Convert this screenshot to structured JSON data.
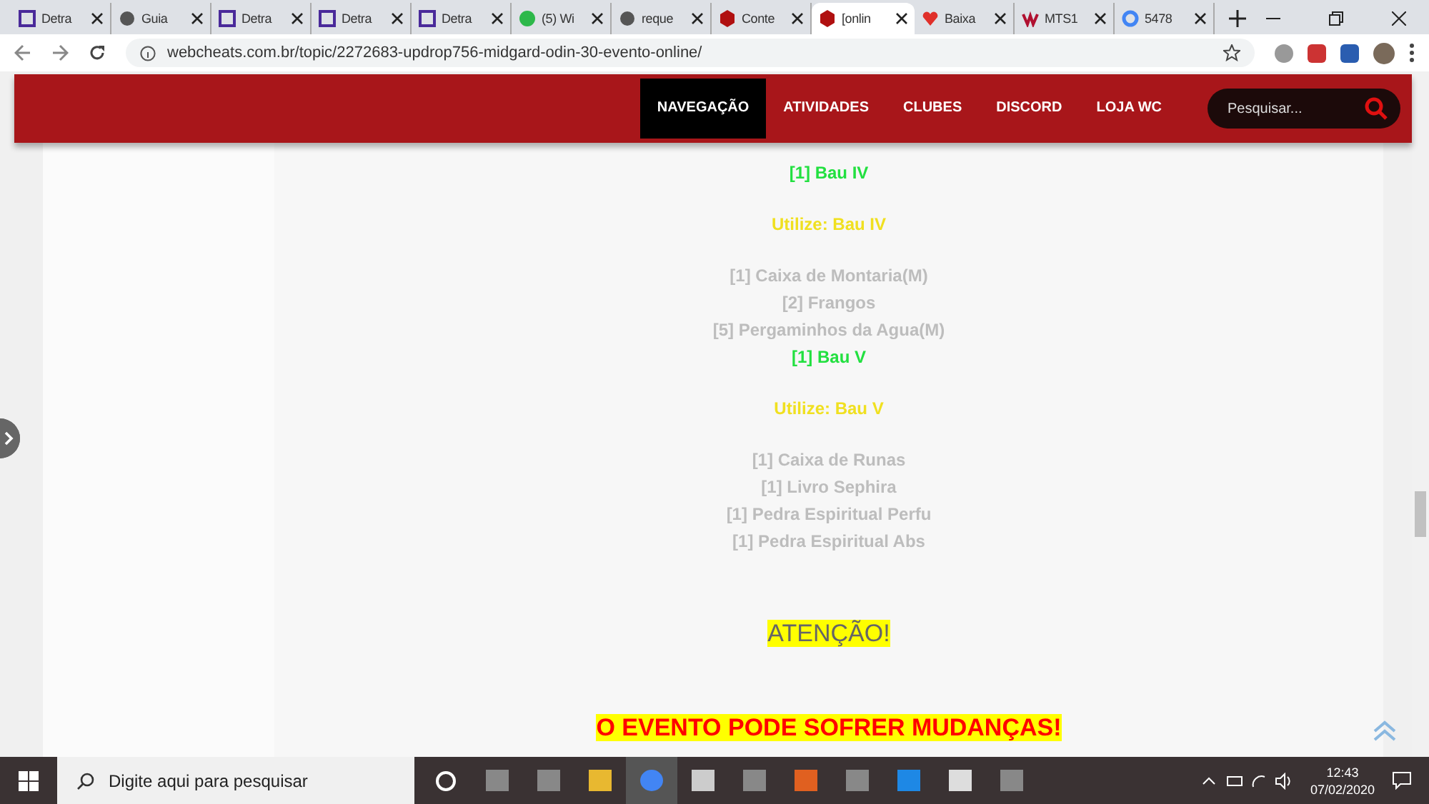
{
  "tabs": [
    {
      "title": "Detra",
      "selected": false
    },
    {
      "title": "Guia",
      "selected": false
    },
    {
      "title": "Detra",
      "selected": false
    },
    {
      "title": "Detra",
      "selected": false
    },
    {
      "title": "Detra",
      "selected": false
    },
    {
      "title": "(5) Wi",
      "selected": false
    },
    {
      "title": "reque",
      "selected": false
    },
    {
      "title": "Conte",
      "selected": false
    },
    {
      "title": "[onlin",
      "selected": true
    },
    {
      "title": "Baixa",
      "selected": false
    },
    {
      "title": "MTS1",
      "selected": false
    },
    {
      "title": "5478",
      "selected": false
    }
  ],
  "address": "webcheats.com.br/topic/2272683-updrop756-midgard-odin-30-evento-online/",
  "nav": [
    {
      "label": "NAVEGAÇÃO",
      "selected": true
    },
    {
      "label": "ATIVIDADES",
      "selected": false
    },
    {
      "label": "CLUBES",
      "selected": false
    },
    {
      "label": "DISCORD",
      "selected": false
    },
    {
      "label": "LOJA WC",
      "selected": false
    }
  ],
  "search": {
    "placeholder": "Pesquisar..."
  },
  "content": [
    {
      "kind": "green",
      "text": "[1] Bau IV"
    },
    {
      "kind": "gap"
    },
    {
      "kind": "yellow",
      "text": "Utilize: Bau IV"
    },
    {
      "kind": "gap"
    },
    {
      "kind": "white",
      "text": "[1] Caixa de Montaria(M)"
    },
    {
      "kind": "white",
      "text": "[2] Frangos"
    },
    {
      "kind": "white",
      "text": "[5] Pergaminhos da Agua(M)"
    },
    {
      "kind": "green",
      "text": "[1] Bau V"
    },
    {
      "kind": "gap"
    },
    {
      "kind": "yellow",
      "text": "Utilize: Bau V"
    },
    {
      "kind": "gap"
    },
    {
      "kind": "white",
      "text": "[1] Caixa de Runas"
    },
    {
      "kind": "white",
      "text": "[1] Livro Sephira"
    },
    {
      "kind": "white",
      "text": "[1] Pedra Espiritual Perfu"
    },
    {
      "kind": "white",
      "text": "[1] Pedra Espiritual Abs"
    },
    {
      "kind": "bigspace"
    },
    {
      "kind": "attention",
      "text": "ATENÇÃO!"
    },
    {
      "kind": "bigspace"
    },
    {
      "kind": "warning",
      "text": "O EVENTO PODE SOFRER MUDANÇAS!"
    }
  ],
  "taskbar": {
    "search_placeholder": "Digite aqui para pesquisar",
    "time": "12:43",
    "date": "07/02/2020"
  }
}
